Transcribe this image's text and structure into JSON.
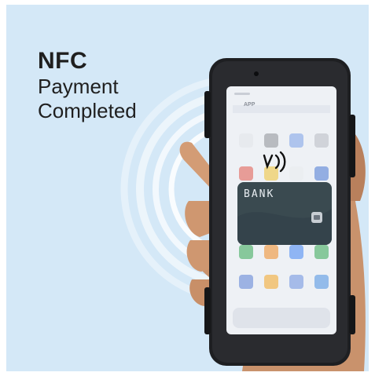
{
  "headline": {
    "title": "NFC",
    "line2": "Payment",
    "line3": "Completed"
  },
  "phone": {
    "app_tab": "APP",
    "card_label": "BANK"
  },
  "icons": [
    "nfc-signal-icon",
    "wallet-icon",
    "wireless-waves-icon"
  ],
  "colors": {
    "background": "#d4e8f7",
    "phone_body": "#1e1f22",
    "card": "#3a4a50",
    "text": "#1f1f1f"
  }
}
